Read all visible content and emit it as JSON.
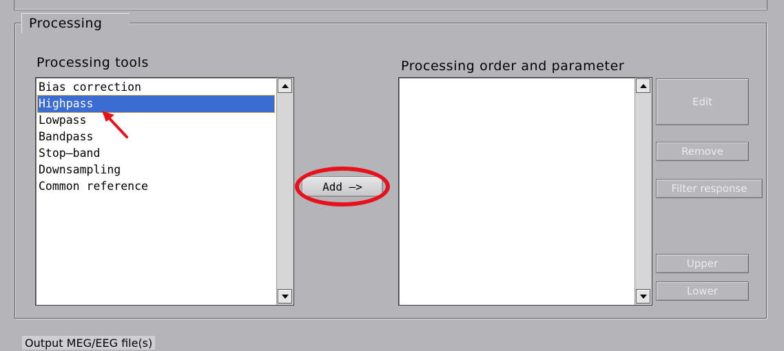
{
  "group": {
    "title": "Processing"
  },
  "tools": {
    "label": "Processing tools",
    "items": [
      "Bias correction",
      "Highpass",
      "Lowpass",
      "Bandpass",
      "Stop–band",
      "Downsampling",
      "Common reference"
    ],
    "selected_index": 1
  },
  "order": {
    "label": "Processing order and parameter",
    "items": []
  },
  "buttons": {
    "add": "Add –>",
    "edit": "Edit",
    "remove": "Remove",
    "filter_response": "Filter response",
    "upper": "Upper",
    "lower": "Lower"
  },
  "bottom": {
    "label": "Output MEG/EEG file(s)"
  },
  "annotations": {
    "ring_color": "#e8101a",
    "arrow_color": "#e8101a"
  }
}
